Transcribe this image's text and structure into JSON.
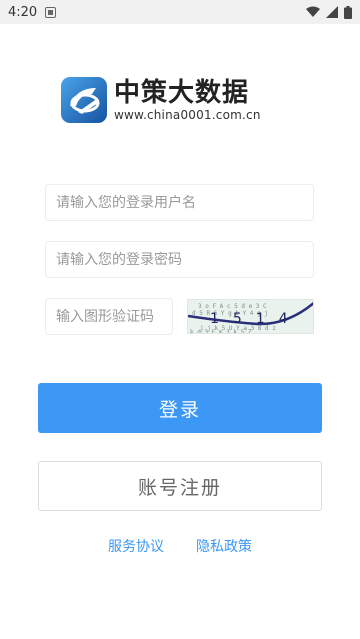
{
  "status_bar": {
    "time": "4:20",
    "app_icon": "notification-icon",
    "icons": [
      "wifi-icon",
      "signal-icon",
      "battery-icon"
    ]
  },
  "logo": {
    "title": "中策大数据",
    "url": "www.china0001.com.cn"
  },
  "form": {
    "username_placeholder": "请输入您的登录用户名",
    "username_value": "",
    "password_placeholder": "请输入您的登录密码",
    "password_value": "",
    "captcha_placeholder": "输入图形验证码",
    "captcha_value": "",
    "captcha_image_text": "1514"
  },
  "buttons": {
    "login": "登录",
    "register": "账号注册"
  },
  "links": {
    "service_agreement": "服务协议",
    "privacy_policy": "隐私政策"
  },
  "colors": {
    "accent": "#3d98f5",
    "logo_blue": "#1e6fc4"
  }
}
